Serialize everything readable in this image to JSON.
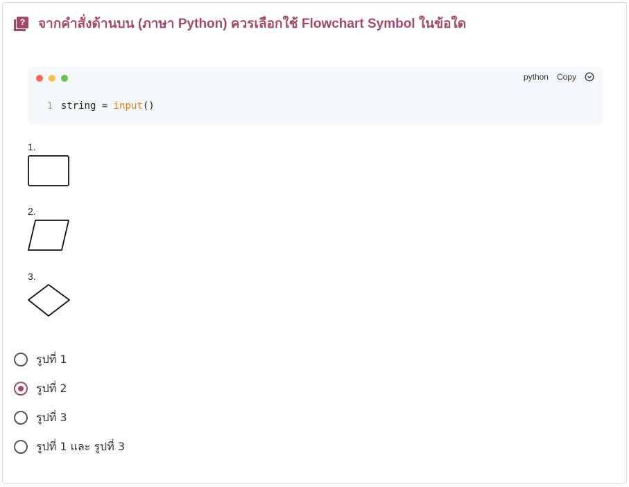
{
  "question": {
    "title": "จากคำสั่งด้านบน (ภาษา Python) ควรเลือกใช้ Flowchart Symbol ในข้อใด",
    "icon": "quiz-icon",
    "accent_color": "#a04a6a"
  },
  "code_block": {
    "language": "python",
    "copy_label": "Copy",
    "collapse_icon": "chevron-down-circle-icon",
    "lines": [
      {
        "number": "1",
        "tokens": {
          "var": "string",
          "op": " = ",
          "fn": "input",
          "punc": "()"
        }
      }
    ]
  },
  "options": [
    {
      "number": "1.",
      "shape": "rectangle"
    },
    {
      "number": "2.",
      "shape": "parallelogram"
    },
    {
      "number": "3.",
      "shape": "diamond"
    }
  ],
  "choices": [
    {
      "label": "รูปที่ 1",
      "selected": false
    },
    {
      "label": "รูปที่ 2",
      "selected": true
    },
    {
      "label": "รูปที่ 3",
      "selected": false
    },
    {
      "label": "รูปที่ 1 และ รูปที่ 3",
      "selected": false
    }
  ]
}
